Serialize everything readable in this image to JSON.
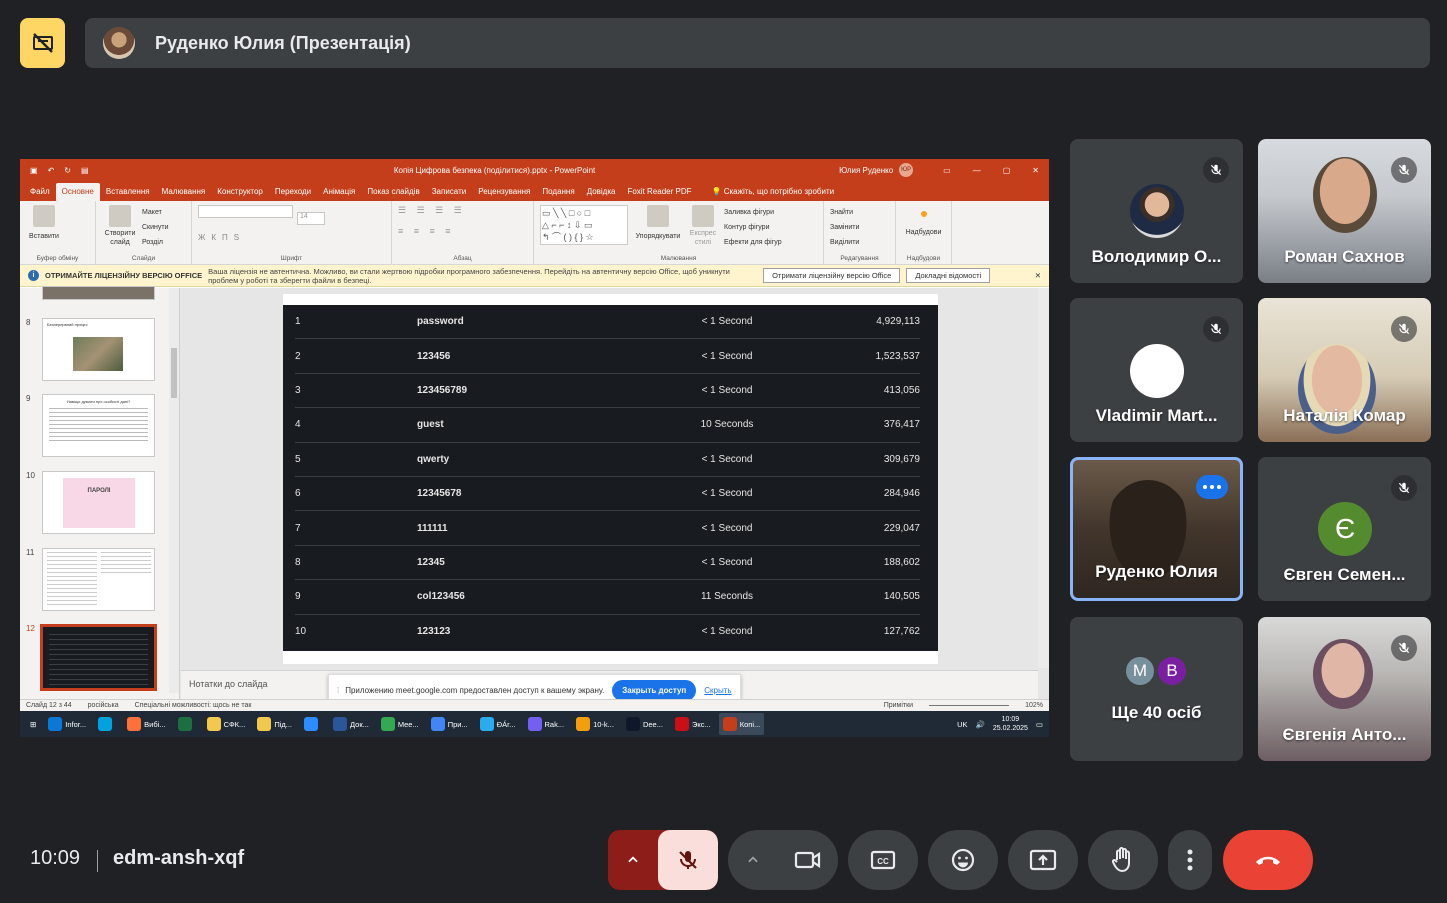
{
  "header": {
    "presenter_title": "Руденко Юлия (Презентація)"
  },
  "powerpoint": {
    "window_title": "Копія Цифрова безпека (поділитися).pptx  -  PowerPoint",
    "user_name": "Юлия Руденко",
    "user_initials": "ЮР",
    "tabs": [
      "Файл",
      "Основне",
      "Вставлення",
      "Малювання",
      "Конструктор",
      "Переходи",
      "Анімація",
      "Показ слайдів",
      "Записати",
      "Рецензування",
      "Подання",
      "Довідка",
      "Foxit Reader PDF"
    ],
    "tell_me": "Скажіть, що потрібно зробити",
    "ribbon": {
      "paste": "Вставити",
      "clipboard": "Буфер обміну",
      "new_slide": "Створити слайд",
      "layout": "Макет",
      "reset": "Скинути",
      "section": "Розділ",
      "slides": "Слайди",
      "font_size": "14",
      "font": "Шрифт",
      "paragraph": "Абзац",
      "arrange": "Упорядкувати",
      "quick_styles": "Експрес стилі",
      "shape_fill": "Заливка фігури",
      "shape_outline": "Контур фігури",
      "shape_effects": "Ефекти для фігур",
      "drawing": "Малювання",
      "find": "Знайти",
      "replace": "Замінити",
      "select": "Виділити",
      "editing": "Редагування",
      "addins": "Надбудови",
      "addins_group": "Надбудови"
    },
    "warning": {
      "title": "ОТРИМАЙТЕ ЛІЦЕНЗІЙНУ ВЕРСІЮ OFFICE",
      "text": "Ваша ліцензія не автентична. Можливо, ви стали жертвою підробки програмного забезпечення. Перейдіть на автентичну версію Office, щоб уникнути проблем у роботі та зберегти файли в безпеці.",
      "btn_get": "Отримати ліцензійну версію Office",
      "btn_more": "Докладні відомості"
    },
    "thumbnails": [
      {
        "num": "8",
        "caption": "Безперервний процес"
      },
      {
        "num": "9",
        "caption": "Навіщо думати про особисті дані?"
      },
      {
        "num": "10",
        "caption": "ПАРОЛІ"
      },
      {
        "num": "11",
        "caption": ""
      },
      {
        "num": "12",
        "caption": ""
      }
    ],
    "slide_table": [
      {
        "rank": "1",
        "password": "password",
        "time": "< 1 Second",
        "count": "4,929,113"
      },
      {
        "rank": "2",
        "password": "123456",
        "time": "< 1 Second",
        "count": "1,523,537"
      },
      {
        "rank": "3",
        "password": "123456789",
        "time": "< 1 Second",
        "count": "413,056"
      },
      {
        "rank": "4",
        "password": "guest",
        "time": "10 Seconds",
        "count": "376,417"
      },
      {
        "rank": "5",
        "password": "qwerty",
        "time": "< 1 Second",
        "count": "309,679"
      },
      {
        "rank": "6",
        "password": "12345678",
        "time": "< 1 Second",
        "count": "284,946"
      },
      {
        "rank": "7",
        "password": "111111",
        "time": "< 1 Second",
        "count": "229,047"
      },
      {
        "rank": "8",
        "password": "12345",
        "time": "< 1 Second",
        "count": "188,602"
      },
      {
        "rank": "9",
        "password": "col123456",
        "time": "11 Seconds",
        "count": "140,505"
      },
      {
        "rank": "10",
        "password": "123123",
        "time": "< 1 Second",
        "count": "127,762"
      }
    ],
    "notes_placeholder": "Нотатки до слайда",
    "share_notice": {
      "text": "Приложению meet.google.com предоставлен доступ к вашему экрану.",
      "stop": "Закрыть доступ",
      "hide": "Скрыть"
    },
    "status": {
      "slide": "Слайд 12 з 44",
      "lang": "російська",
      "accessibility": "Спеціальні можливості: щось не так",
      "notes": "Примітки",
      "zoom": "102%"
    },
    "taskbar": {
      "apps": [
        "Infor...",
        "",
        "Вибі...",
        "",
        "СФК...",
        "Під...",
        "",
        "Док...",
        "Mee...",
        "При...",
        "ÐÁr...",
        "Rak...",
        "10-k...",
        "Dee...",
        "Экс...",
        "Копі..."
      ],
      "lang": "UK",
      "time": "10:09",
      "date": "25.02.2025"
    }
  },
  "participants": [
    {
      "name": "Володимир О...",
      "muted": true
    },
    {
      "name": "Роман Сахнов",
      "muted": true
    },
    {
      "name": "Vladimir Mart...",
      "muted": true
    },
    {
      "name": "Наталія Комар",
      "muted": true
    },
    {
      "name": "Руденко Юлия",
      "muted": false
    },
    {
      "name": "Євген Семен...",
      "muted": true,
      "initial": "Є",
      "color": "#558b2f"
    },
    {
      "name": "Ще 40 осіб",
      "initials": [
        "M",
        "B"
      ],
      "colors": [
        "#78909c",
        "#7b1fa2"
      ]
    },
    {
      "name": "Євгенія Анто...",
      "muted": true
    }
  ],
  "footer": {
    "time": "10:09",
    "meeting_code": "edm-ansh-xqf"
  },
  "colors": {
    "meet_bg": "#202124",
    "tile_bg": "#3c4043",
    "end_call": "#ea4335",
    "mic_off_bg": "#f9dedc",
    "powerpoint": "#c43e1c"
  }
}
